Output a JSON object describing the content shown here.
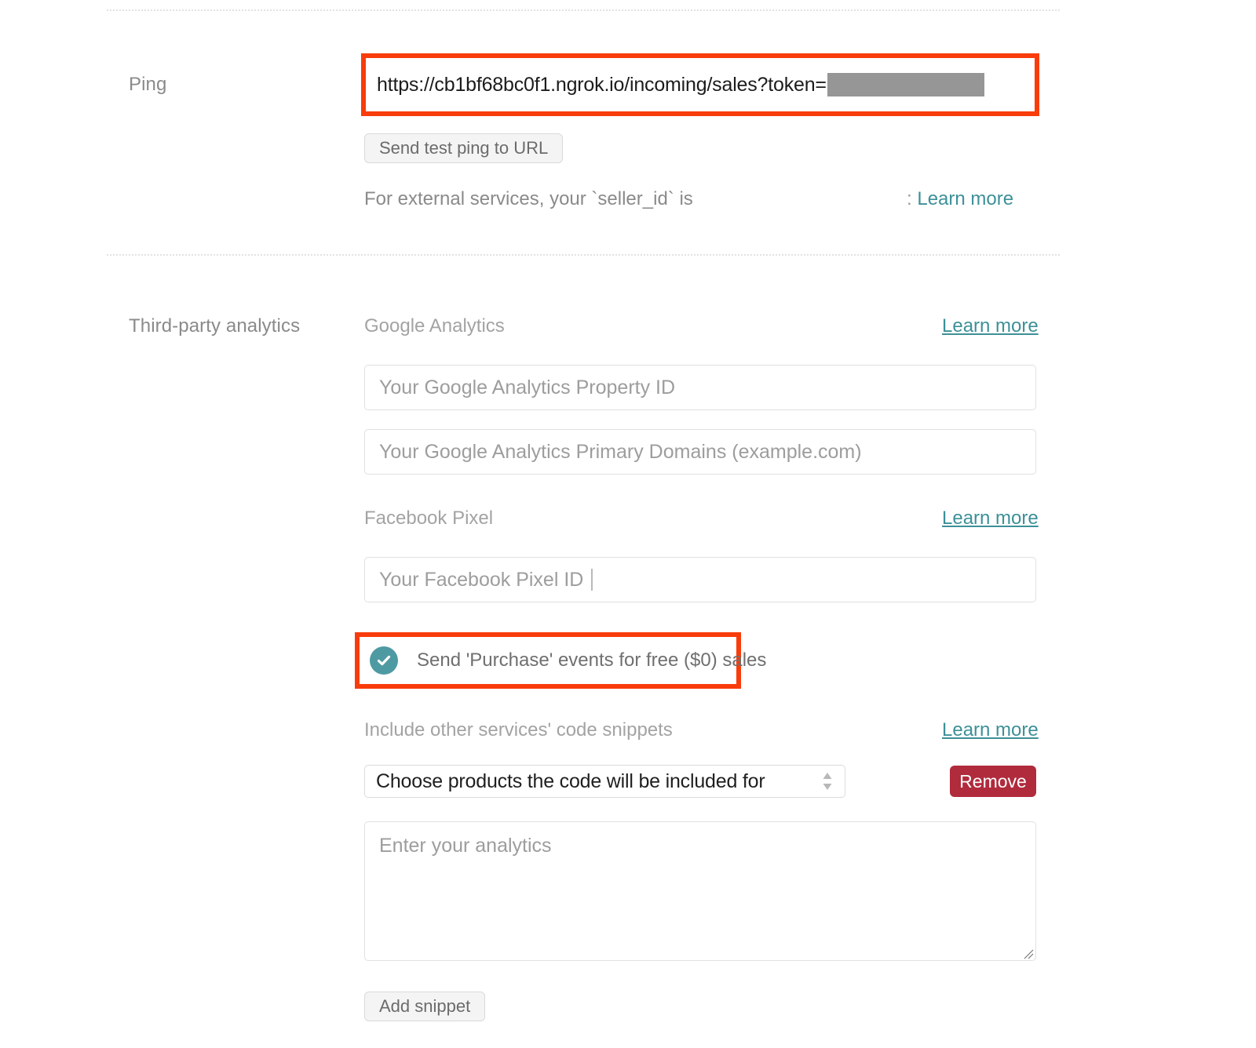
{
  "ping_section": {
    "label": "Ping",
    "url_value": "https://cb1bf68bc0f1.ngrok.io/incoming/sales?token=",
    "url_redacted": true,
    "send_test_button": "Send test ping to URL",
    "seller_id_note": "For external services, your `seller_id` is",
    "seller_id_prefix": ":",
    "seller_id_learn_more": "Learn more"
  },
  "analytics_section": {
    "label": "Third-party analytics",
    "google_analytics": {
      "heading": "Google Analytics",
      "learn_more": "Learn more",
      "property_id_placeholder": "Your Google Analytics Property ID",
      "property_id_value": "",
      "domains_placeholder": "Your Google Analytics Primary Domains (example.com)",
      "domains_value": ""
    },
    "facebook_pixel": {
      "heading": "Facebook Pixel",
      "learn_more": "Learn more",
      "pixel_id_placeholder": "Your Facebook Pixel ID",
      "pixel_id_value": "",
      "purchase_events_label": "Send 'Purchase' events for free ($0) sales",
      "purchase_events_checked": true
    },
    "code_snippets": {
      "heading": "Include other services' code snippets",
      "learn_more": "Learn more",
      "products_select_value": "Choose products the code will be included for",
      "remove_button": "Remove",
      "textarea_placeholder": "Enter your analytics",
      "textarea_value": "",
      "add_snippet_button": "Add snippet"
    }
  },
  "colors": {
    "annotation_red": "#f93c0b",
    "teal_accent": "#4e9aa3",
    "link_teal": "#3d9098",
    "remove_red": "#b02b3c",
    "redaction_gray": "#969696"
  },
  "icons": {
    "check": "check-icon",
    "stepper": "select-stepper-icon",
    "resize": "resize-handle-icon"
  }
}
